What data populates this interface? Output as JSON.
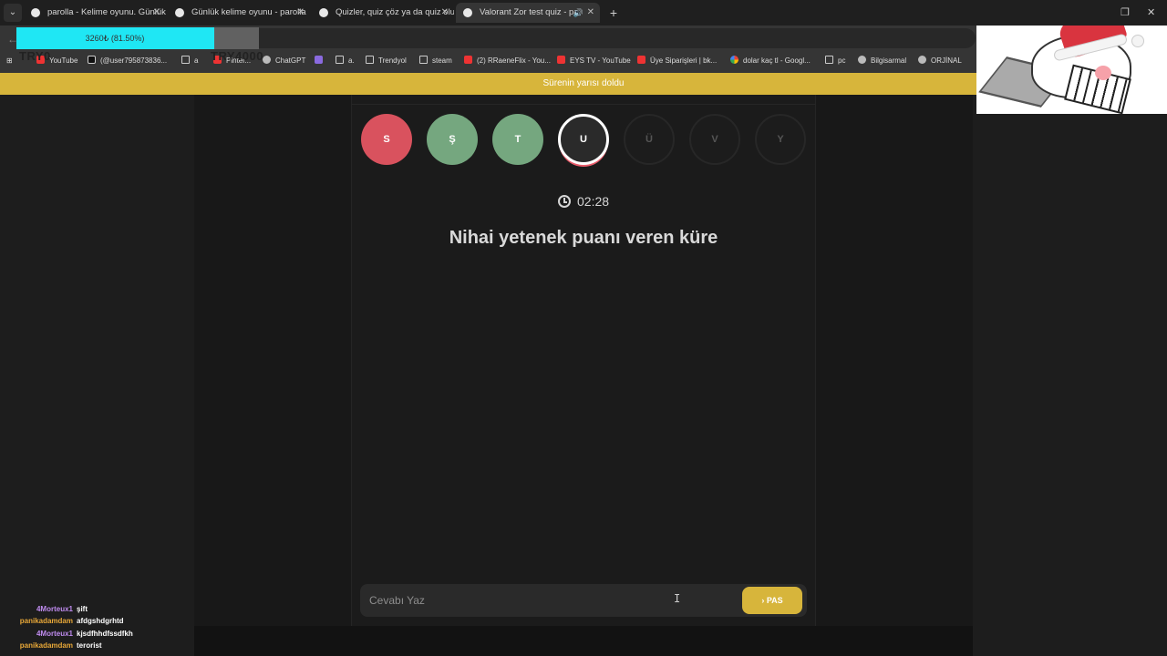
{
  "browser": {
    "tabs": [
      {
        "label": "parolla - Kelime oyunu. Günlük",
        "active": false
      },
      {
        "label": "Günlük kelime oyunu - parolla",
        "active": false
      },
      {
        "label": "Quizler, quiz çöz ya da quiz olu",
        "active": false
      },
      {
        "label": "Valorant Zor test quiz - pa",
        "active": true
      }
    ],
    "bookmarks": [
      {
        "label": "YouTube",
        "icon": "youtube-icon"
      },
      {
        "label": "(@user795873836...",
        "icon": "tiktok-icon"
      },
      {
        "label": "a",
        "icon": "folder-icon"
      },
      {
        "label": "Pinter...",
        "icon": "pinterest-icon"
      },
      {
        "label": "ChatGPT",
        "icon": "chatgpt-icon"
      },
      {
        "label": "",
        "icon": "rocket-icon"
      },
      {
        "label": "a.",
        "icon": "folder-icon"
      },
      {
        "label": "Trendyol",
        "icon": "folder-icon"
      },
      {
        "label": "steam",
        "icon": "folder-icon"
      },
      {
        "label": "(2) RRaeneFlix - You...",
        "icon": "youtube-icon"
      },
      {
        "label": "EYS TV - YouTube",
        "icon": "youtube-icon"
      },
      {
        "label": "Üye Siparişleri | bk...",
        "icon": "store-icon"
      },
      {
        "label": "dolar kaç tl - Googl...",
        "icon": "google-icon"
      },
      {
        "label": "pc",
        "icon": "folder-icon"
      },
      {
        "label": "Bilgisarmal",
        "icon": "globe-icon"
      },
      {
        "label": "ORJİNAL",
        "icon": "globe-icon"
      }
    ]
  },
  "stream_overlay": {
    "donation_progress_text": "3260₺ (81.50%)",
    "donation_progress_fraction": 0.815,
    "left_label": "TRY0",
    "right_label": "TRY4000"
  },
  "banner": {
    "text": "Sürenin yarısı doldu",
    "color": "#d7b53b"
  },
  "quiz": {
    "letters": [
      {
        "letter": "S",
        "state": "wrong"
      },
      {
        "letter": "Ş",
        "state": "correct"
      },
      {
        "letter": "T",
        "state": "correct"
      },
      {
        "letter": "U",
        "state": "current"
      },
      {
        "letter": "Ü",
        "state": "pending"
      },
      {
        "letter": "V",
        "state": "pending"
      },
      {
        "letter": "Y",
        "state": "pending"
      }
    ],
    "timer": "02:28",
    "question": "Nihai yetenek puanı veren küre",
    "answer_placeholder": "Cevabı Yaz",
    "pass_label": "PAS",
    "colors": {
      "wrong": "#d9525e",
      "correct": "#75a77f",
      "accent": "#d7b53b"
    }
  },
  "chat": [
    {
      "user": "4Morteux1",
      "message": "şift",
      "color": "#c08cf0"
    },
    {
      "user": "panikadamdam",
      "message": "afdgshdgrhtd",
      "color": "#e8a838"
    },
    {
      "user": "4Morteux1",
      "message": "kjsdfhhdfssdfkh",
      "color": "#c08cf0"
    },
    {
      "user": "panikadamdam",
      "message": "terorist",
      "color": "#e8a838"
    }
  ]
}
